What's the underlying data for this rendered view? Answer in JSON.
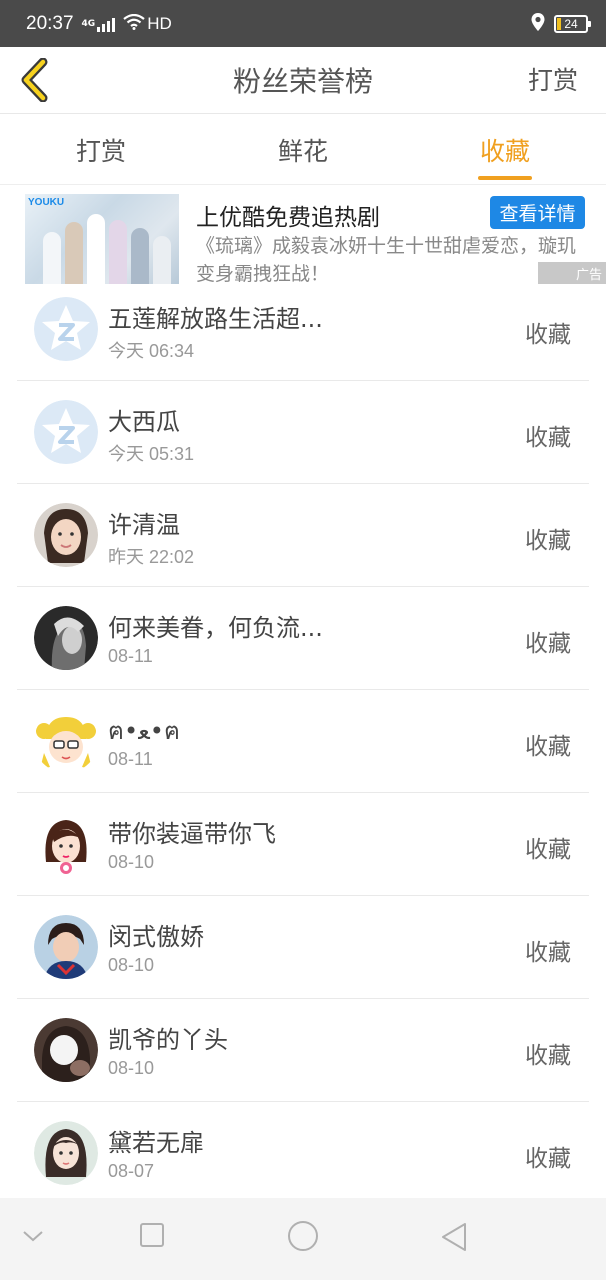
{
  "status_bar": {
    "time": "20:37",
    "network": "4G",
    "hd": "HD",
    "battery": "24"
  },
  "header": {
    "title": "粉丝荣誉榜",
    "right_action": "打赏"
  },
  "tabs": [
    {
      "label": "打赏",
      "active": false
    },
    {
      "label": "鲜花",
      "active": false
    },
    {
      "label": "收藏",
      "active": true
    }
  ],
  "ad": {
    "logo": "YOUKU",
    "headline": "上优酷免费追热剧",
    "cta": "查看详情",
    "description": "《琉璃》成毅袁冰妍十生十世甜虐爱恋，璇玑变身霸拽狂战！",
    "badge": "广告"
  },
  "list": [
    {
      "name": "五莲解放路生活超...",
      "time": "今天 06:34",
      "action": "收藏",
      "avatar": "default-star-icon"
    },
    {
      "name": "大西瓜",
      "time": "今天 05:31",
      "action": "收藏",
      "avatar": "default-star-icon"
    },
    {
      "name": "许清温",
      "time": "昨天 22:02",
      "action": "收藏",
      "avatar": "photo-avatar"
    },
    {
      "name": "何来美眷，何负流...",
      "time": "08-11",
      "action": "收藏",
      "avatar": "photo-avatar"
    },
    {
      "name": "ฅ•ﻌ•ฅ",
      "time": "08-11",
      "action": "收藏",
      "avatar": "cartoon-avatar"
    },
    {
      "name": "带你装逼带你飞",
      "time": "08-10",
      "action": "收藏",
      "avatar": "cartoon-avatar"
    },
    {
      "name": "闵式傲娇",
      "time": "08-10",
      "action": "收藏",
      "avatar": "photo-avatar"
    },
    {
      "name": "凯爷的丫头",
      "time": "08-10",
      "action": "收藏",
      "avatar": "photo-avatar"
    },
    {
      "name": "黛若无扉",
      "time": "08-07",
      "action": "收藏",
      "avatar": "photo-avatar"
    }
  ],
  "colors": {
    "accent": "#f0a020",
    "cta_blue": "#1e88e5",
    "status_bar": "#4a4a4a"
  }
}
